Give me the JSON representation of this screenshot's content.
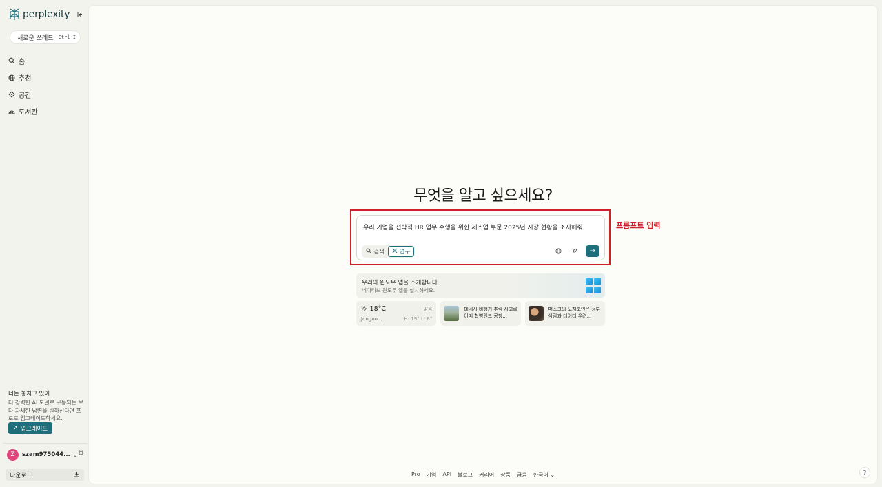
{
  "sidebar": {
    "logo_text": "perplexity",
    "new_thread": {
      "label": "새로운 쓰레드",
      "shortcut": "Ctrl I"
    },
    "nav_items": [
      {
        "label": "홈",
        "icon": "search-icon"
      },
      {
        "label": "추천",
        "icon": "globe-icon"
      },
      {
        "label": "공간",
        "icon": "spaces-icon"
      },
      {
        "label": "도서관",
        "icon": "library-icon"
      }
    ],
    "promo": {
      "title": "너는 놓치고 있어",
      "body": "더 강력한 AI 모델로 구동되는 보다 자세한 답변을 원하신다면 프로로 업그레이드하세요.",
      "button": "업그레이드"
    },
    "user": {
      "avatar_initial": "Z",
      "name": "szam975044..."
    },
    "download_label": "다운로드"
  },
  "main": {
    "headline": "무엇을 알고 싶으세요?",
    "search": {
      "value": "우리 기업을 전략적 HR 업무 수행을 위한 제조업 부문 2025년 시장 현황을 조사해줘",
      "modes": [
        "검색",
        "연구"
      ],
      "active_mode": "연구"
    },
    "annotation": "프롬프트 입력",
    "banner": {
      "title": "우리의 윈도우 앱을 소개합니다",
      "subtitle": "네이티브 윈도우 앱을 설치하세요."
    },
    "weather": {
      "temp": "18°C",
      "condition": "맑음",
      "location": "Jongno...",
      "high_low": "H: 19° L: 8°"
    },
    "news": [
      {
        "title": "테네시 비행기 추락 사고로 어떠 협병랜드 공항..."
      },
      {
        "title": "머스크의 도지코인은 정부 삭감과 데이터 우려..."
      }
    ],
    "footer_links": [
      "Pro",
      "기업",
      "API",
      "블로그",
      "커리어",
      "상품",
      "금융",
      "한국어"
    ],
    "help": "?"
  },
  "colors": {
    "accent": "#1e6f7c",
    "annotation": "#d0202a",
    "avatar": "#e0457b"
  }
}
